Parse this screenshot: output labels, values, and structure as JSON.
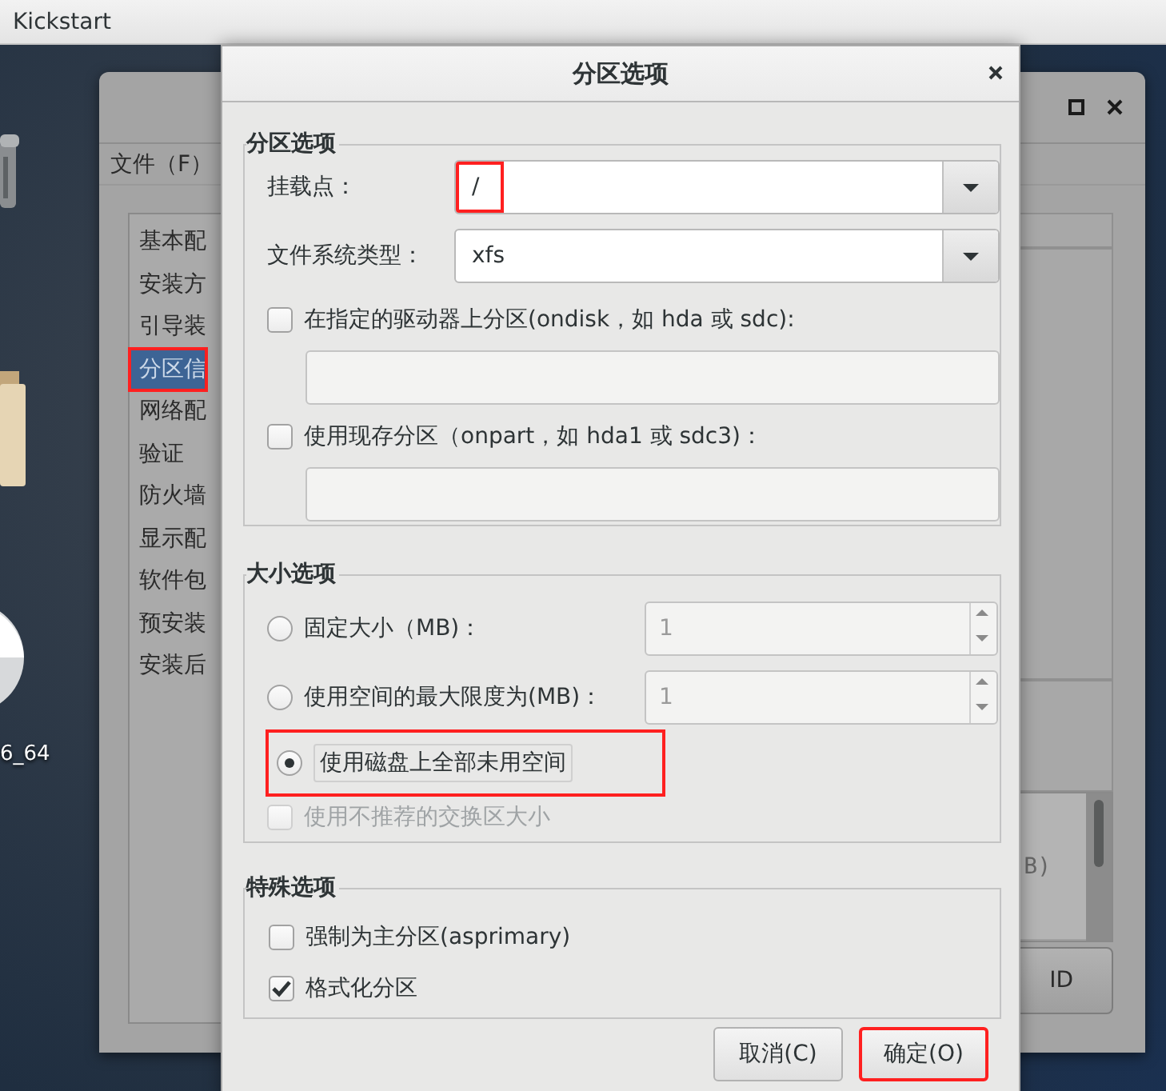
{
  "top_bar": {
    "title": "Kickstart"
  },
  "desktop_icons": [
    {
      "kind": "trash"
    },
    {
      "kind": "folder"
    },
    {
      "kind": "disc",
      "label": "6_64"
    }
  ],
  "background_window": {
    "menu": [
      "文件（F）"
    ],
    "sidebar": {
      "items": [
        {
          "label": "基本配",
          "selected": false,
          "highlighted": false
        },
        {
          "label": "安装方",
          "selected": false,
          "highlighted": false
        },
        {
          "label": "引导装",
          "selected": false,
          "highlighted": false
        },
        {
          "label": "分区信",
          "selected": true,
          "highlighted": true
        },
        {
          "label": "网络配",
          "selected": false,
          "highlighted": false
        },
        {
          "label": "验证",
          "selected": false,
          "highlighted": false
        },
        {
          "label": "防火墙",
          "selected": false,
          "highlighted": false
        },
        {
          "label": "显示配",
          "selected": false,
          "highlighted": false
        },
        {
          "label": "软件包",
          "selected": false,
          "highlighted": false
        },
        {
          "label": "预安装",
          "selected": false,
          "highlighted": false
        },
        {
          "label": "安装后",
          "selected": false,
          "highlighted": false
        }
      ]
    },
    "list_cell": "B)",
    "button": "ID"
  },
  "dialog": {
    "title": "分区选项",
    "partition_options": {
      "legend": "分区选项",
      "fields": [
        {
          "label": "挂载点：",
          "value": "/",
          "highlighted": true
        },
        {
          "label": "文件系统类型：",
          "value": "xfs",
          "highlighted": false
        }
      ],
      "drive_options": [
        {
          "label": "在指定的驱动器上分区(ondisk，如 hda 或 sdc):",
          "checked": false
        },
        {
          "label": "使用现存分区（onpart，如 hda1 或 sdc3)：",
          "checked": false
        }
      ]
    },
    "size_options": {
      "legend": "大小选项",
      "choices": [
        {
          "kind": "spin",
          "label": "固定大小（MB)：",
          "value": "1",
          "disabled": true,
          "selected": false,
          "highlighted": false
        },
        {
          "kind": "spin",
          "label": "使用空间的最大限度为(MB)：",
          "value": "1",
          "disabled": true,
          "selected": false,
          "highlighted": false
        },
        {
          "kind": "plain",
          "label": "使用磁盘上全部未用空间",
          "selected": true,
          "highlighted": true
        }
      ],
      "swap": {
        "label": "使用不推荐的交换区大小",
        "checked": false,
        "disabled": true
      }
    },
    "special_options": {
      "legend": "特殊选项",
      "options": [
        {
          "label": "强制为主分区(asprimary)",
          "checked": false
        },
        {
          "label": "格式化分区",
          "checked": true
        }
      ]
    },
    "buttons": [
      {
        "label": "取消(C)",
        "highlighted": false
      },
      {
        "label": "确定(O)",
        "highlighted": true
      }
    ]
  }
}
